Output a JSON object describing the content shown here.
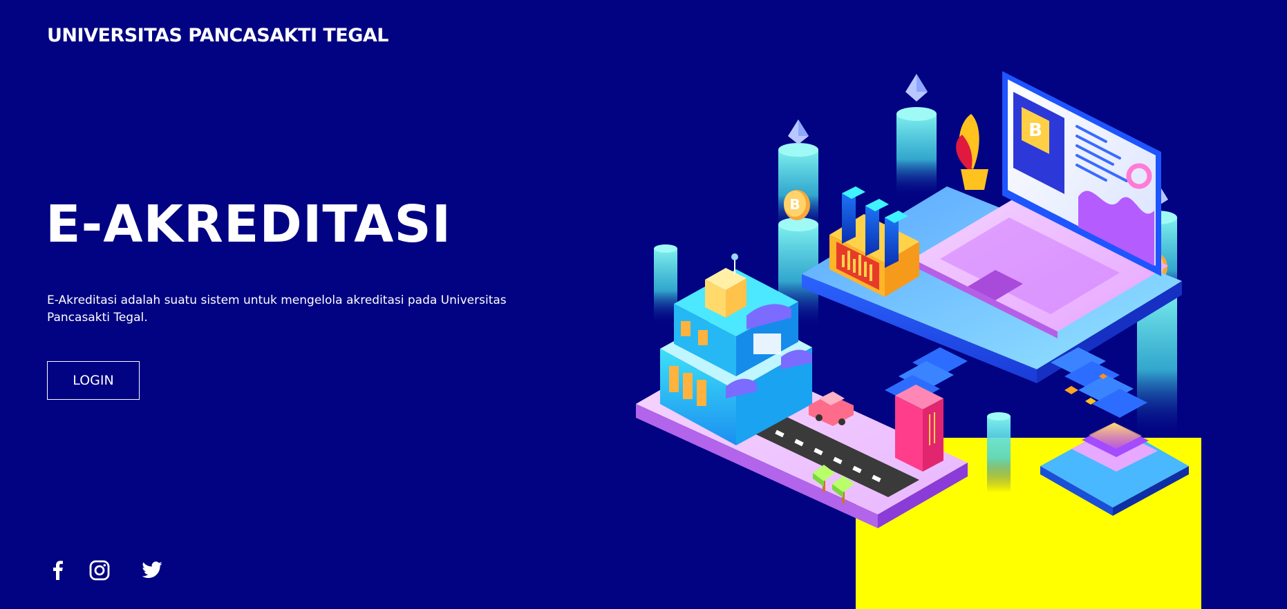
{
  "header": {
    "brand": "UNIVERSITAS PANCASAKTI TEGAL"
  },
  "hero": {
    "title": "E-AKREDITASI",
    "description": "E-Akreditasi adalah suatu sistem untuk mengelola akreditasi pada Universitas Pancasakti Tegal.",
    "login_label": "LOGIN"
  },
  "illustration": {
    "coin_letter": "B"
  },
  "socials": [
    {
      "icon": "facebook-icon"
    },
    {
      "icon": "instagram-icon"
    },
    {
      "icon": "twitter-icon"
    }
  ],
  "colors": {
    "background": "#020382",
    "text": "#ffffff",
    "accent_yellow": "#ffff00"
  }
}
